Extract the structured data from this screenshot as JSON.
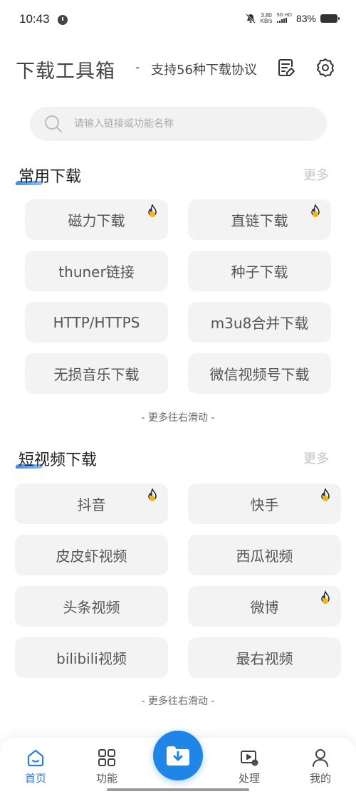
{
  "status_bar": {
    "time": "10:43",
    "speed_value": "3.80",
    "speed_unit": "KB/s",
    "network": "5G HD",
    "battery": "83%"
  },
  "header": {
    "title": "下载工具箱",
    "dash": "-",
    "subtitle": "支持56种下载协议",
    "edit_icon": "edit-note-icon",
    "settings_icon": "settings-icon"
  },
  "search": {
    "placeholder": "请输入链接或功能名称"
  },
  "sections": [
    {
      "title": "常用下载",
      "more": "更多",
      "items": [
        {
          "label": "磁力下载",
          "hot": true
        },
        {
          "label": "直链下载",
          "hot": true
        },
        {
          "label": "thuner链接",
          "hot": false
        },
        {
          "label": "种子下载",
          "hot": false
        },
        {
          "label": "HTTP/HTTPS",
          "hot": false
        },
        {
          "label": "m3u8合并下载",
          "hot": false
        },
        {
          "label": "无损音乐下载",
          "hot": false
        },
        {
          "label": "微信视频号下载",
          "hot": false
        }
      ],
      "hint": "- 更多往右滑动 -"
    },
    {
      "title": "短视频下载",
      "more": "更多",
      "items": [
        {
          "label": "抖音",
          "hot": true
        },
        {
          "label": "快手",
          "hot": true
        },
        {
          "label": "皮皮虾视频",
          "hot": false
        },
        {
          "label": "西瓜视频",
          "hot": false
        },
        {
          "label": "头条视频",
          "hot": false
        },
        {
          "label": "微博",
          "hot": true
        },
        {
          "label": "bilibili视频",
          "hot": false
        },
        {
          "label": "最右视频",
          "hot": false
        }
      ],
      "hint": "- 更多往右滑动 -"
    }
  ],
  "bottom_nav": {
    "items": [
      {
        "label": "首页",
        "icon": "home-icon",
        "active": true
      },
      {
        "label": "功能",
        "icon": "grid-icon",
        "active": false
      },
      {
        "label": "处理",
        "icon": "video-settings-icon",
        "active": false
      },
      {
        "label": "我的",
        "icon": "user-icon",
        "active": false
      }
    ],
    "fab_icon": "download-folder-icon"
  },
  "colors": {
    "accent": "#1f86e8",
    "tile_bg": "#f3f3f3",
    "hot_badge": "#f5b50a"
  }
}
